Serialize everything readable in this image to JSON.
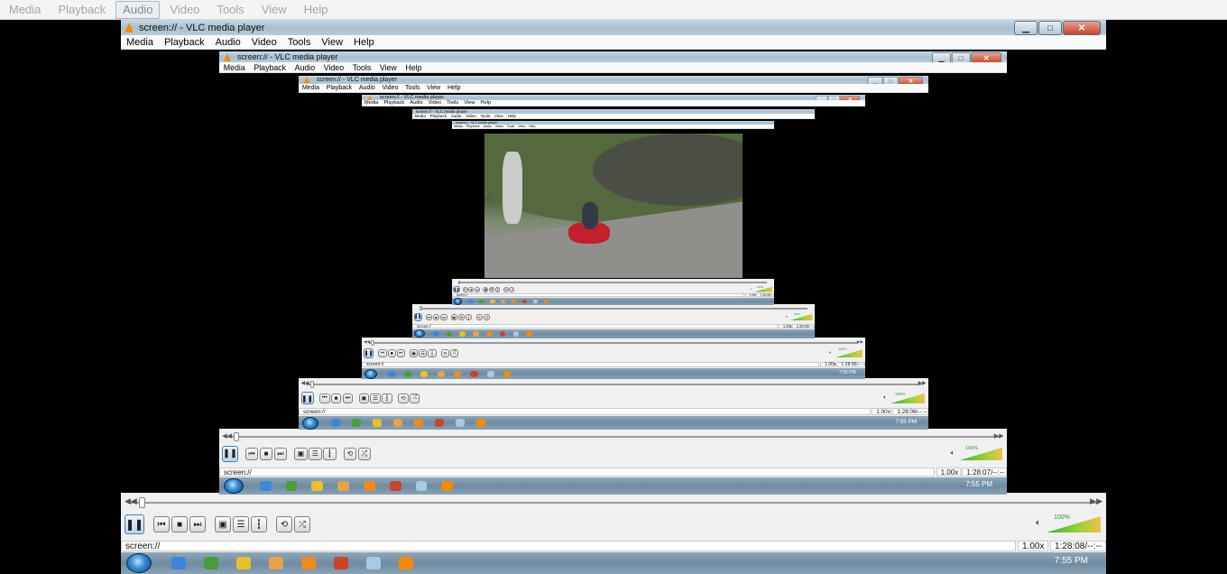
{
  "outer_menu": {
    "items": [
      "Media",
      "Playback",
      "Audio",
      "Video",
      "Tools",
      "View",
      "Help"
    ],
    "active": "Audio"
  },
  "window": {
    "title": "screen:// - VLC media player",
    "menu": [
      "Media",
      "Playback",
      "Audio",
      "Video",
      "Tools",
      "View",
      "Help"
    ]
  },
  "player": {
    "source": "screen://",
    "speed": "1.00x",
    "volume_label": "100%",
    "time_main": "1:28:08/--:--",
    "time_levels": [
      "1:28:08/--:--",
      "1:28:07/--:--",
      "1:28:06/--:--",
      "1:28:05/--:--"
    ]
  },
  "taskbar": {
    "clock": "7:55 PM",
    "clock_small": "7:55 PM"
  },
  "icons": {
    "prev": "skip-back-icon",
    "stop": "stop-icon",
    "next": "skip-forward-icon",
    "fullscreen": "fullscreen-icon",
    "playlist": "playlist-icon",
    "extended": "equalizer-icon",
    "loop": "loop-icon",
    "shuffle": "shuffle-icon",
    "pause": "pause-icon"
  },
  "colors": {
    "vlc_orange": "#f28a0a",
    "taskbar": "#7a95ab",
    "close_red": "#c8452c"
  }
}
